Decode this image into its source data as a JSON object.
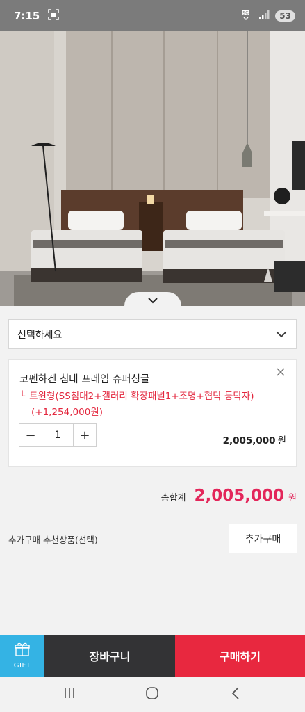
{
  "status_bar": {
    "time": "7:15",
    "battery": "53",
    "icons": [
      "screenshot-icon",
      "wifi-5g-icon",
      "signal-icon"
    ]
  },
  "hero": {
    "image": "twin-bed-bedroom-photo",
    "collapse_icon": "chevron-down-icon"
  },
  "option_select": {
    "placeholder": "선택하세요"
  },
  "selected_item": {
    "name": "코펜하겐 침대 프레임 슈퍼싱글",
    "branch_glyph": "└",
    "option": "트윈형(SS침대2+갤러리 확장패널1+조명+협탁 등탁자)",
    "option_price": "(+1,254,000원)",
    "quantity": "1",
    "minus": "−",
    "plus": "+",
    "price": "2,005,000",
    "price_unit": "원"
  },
  "total": {
    "label": "총합계",
    "value": "2,005,000",
    "unit": "원"
  },
  "additional": {
    "label": "추가구매 추천상품(선택)",
    "button": "추가구매"
  },
  "action_bar": {
    "gift": "GIFT",
    "cart": "장바구니",
    "buy": "구매하기"
  },
  "colors": {
    "accent_red": "#e8283f",
    "price_pink": "#e3265a",
    "gift_blue": "#34b3e4",
    "cart_dark": "#333335"
  }
}
